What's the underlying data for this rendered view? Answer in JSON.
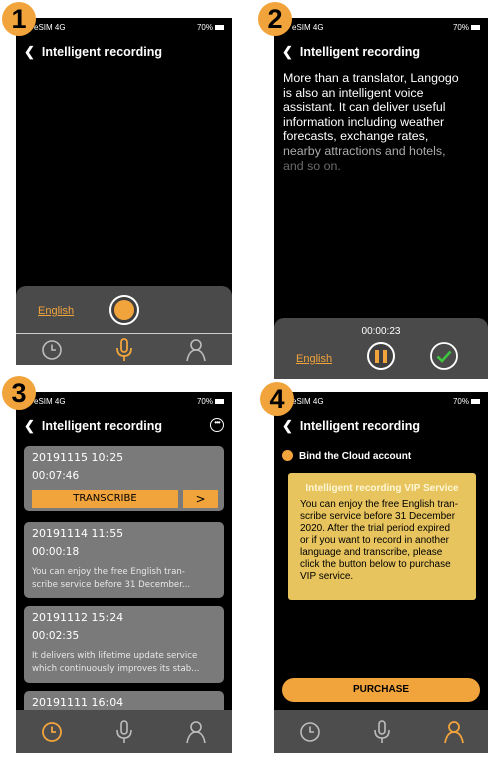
{
  "badges": [
    "1",
    "2",
    "3",
    "4"
  ],
  "status": {
    "carrier": "eSIM 4G",
    "battery": "70%"
  },
  "title": "Intelligent recording",
  "screen1": {
    "language": "English"
  },
  "screen2": {
    "text_lines": [
      "More than a translator, Langogo",
      "is also an intelligent voice",
      "assistant. It can deliver useful",
      "information including weather",
      "forecasts, exchange rates,",
      "nearby attractions and hotels,",
      "and so on."
    ],
    "timer": "00:00:23",
    "language": "English"
  },
  "screen3": {
    "recordings": [
      {
        "date": "20191115 10:25",
        "duration": "00:07:46",
        "action": "TRANSCRIBE",
        "arrow": ">"
      },
      {
        "date": "20191114 11:55",
        "duration": "00:00:18",
        "desc_lines": [
          "You can enjoy the free English tran-",
          "scribe service before 31 December..."
        ]
      },
      {
        "date": "20191112 15:24",
        "duration": "00:02:35",
        "desc_lines": [
          "It delivers with lifetime update service",
          "which continuously improves its stab..."
        ]
      },
      {
        "date": "20191111 16:04"
      }
    ]
  },
  "screen4": {
    "bind_label": "Bind the Cloud account",
    "vip_title": "Intelligent recording VIP Service",
    "vip_lines": [
      "You can enjoy the free English tran-",
      "scribe service before 31 December",
      "2020. After the trial period expired",
      "or if you want to record in another",
      "language and transcribe, please",
      "click the button below to purchase",
      "VIP service."
    ],
    "purchase_label": "PURCHASE"
  },
  "colors": {
    "accent": "#f2a43c",
    "panel": "#4a4a4a",
    "card": "#7a7a7a",
    "vip": "#e7c45e"
  },
  "tabs": [
    "history-clock-icon",
    "microphone-icon",
    "profile-icon"
  ]
}
